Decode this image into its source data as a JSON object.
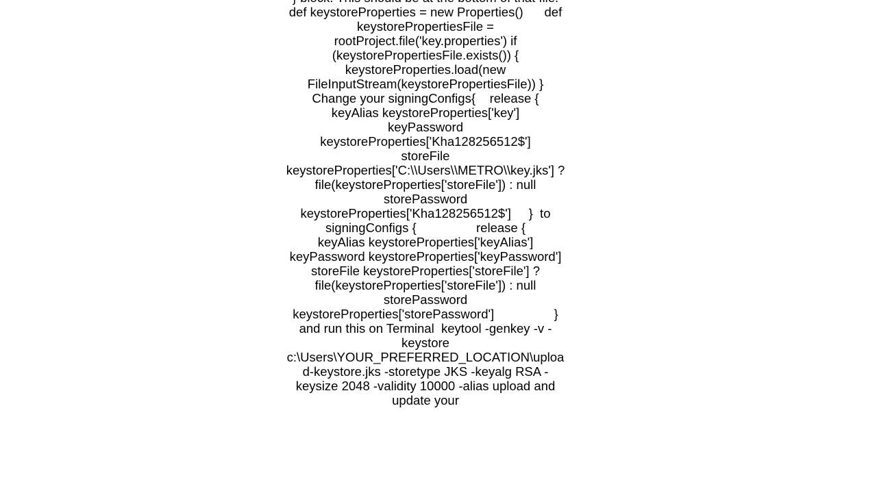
{
  "document": {
    "body_text": "} block. This should be at the bottom of that file. def keystoreProperties = new Properties()      def keystorePropertiesFile = rootProject.file('key.properties') if (keystorePropertiesFile.exists()) {     keystoreProperties.load(new FileInputStream(keystorePropertiesFile)) }  Change your signingConfigs{    release {         keyAlias keystoreProperties['key']         keyPassword keystoreProperties['Kha128256512$']         storeFile keystoreProperties['C:\\\\Users\\\\METRO\\\\key.jks'] ? file(keystoreProperties['storeFile']) : null         storePassword keystoreProperties['Kha128256512$']     }  to signingConfigs {                 release {                     keyAlias keystoreProperties['keyAlias']                     keyPassword keystoreProperties['keyPassword']                     storeFile keystoreProperties['storeFile'] ? file(keystoreProperties['storeFile']) : null                     storePassword keystoreProperties['storePassword']                 }  and run this on Terminal  keytool -genkey -v -keystore c:\\Users\\YOUR_PREFERRED_LOCATION\\upload-keystore.jks -storetype JKS -keyalg RSA -keysize 2048 -validity 10000 -alias upload and update your"
  }
}
